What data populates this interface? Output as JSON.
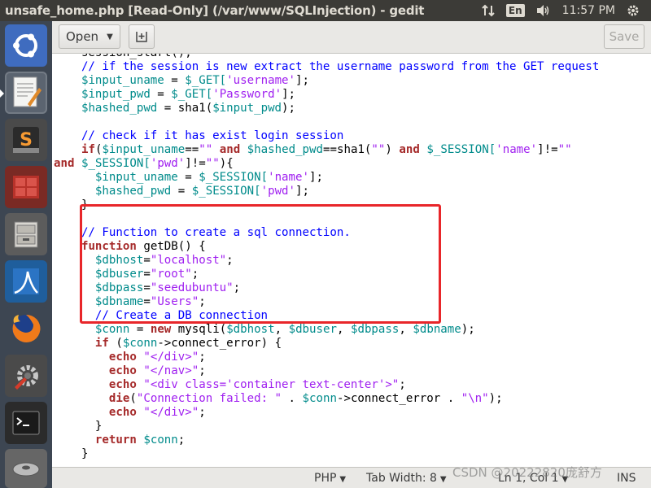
{
  "window": {
    "title": "unsafe_home.php [Read-Only] (/var/www/SQLInjection) - gedit"
  },
  "indicators": {
    "language": "En",
    "clock": "11:57 PM"
  },
  "launcher": {
    "items": [
      {
        "name": "ubuntu-dash-icon"
      },
      {
        "name": "text-editor-icon"
      },
      {
        "name": "sublime-text-icon"
      },
      {
        "name": "workspace-switcher-icon"
      },
      {
        "name": "file-manager-icon"
      },
      {
        "name": "wireshark-icon"
      },
      {
        "name": "firefox-icon"
      },
      {
        "name": "system-settings-icon"
      },
      {
        "name": "terminal-icon"
      },
      {
        "name": "disk-icon"
      }
    ]
  },
  "toolbar": {
    "open_label": "Open",
    "save_label": "Save"
  },
  "code": {
    "lines": [
      [
        {
          "t": "    session_start();",
          "c": ""
        }
      ],
      [
        {
          "t": "    // if the session is new extract the username password from the GET request",
          "c": "cmt"
        }
      ],
      [
        {
          "t": "    ",
          "c": ""
        },
        {
          "t": "$input_uname",
          "c": "var"
        },
        {
          "t": " = ",
          "c": ""
        },
        {
          "t": "$_GET[",
          "c": "var"
        },
        {
          "t": "'username'",
          "c": "str"
        },
        {
          "t": "];",
          "c": ""
        }
      ],
      [
        {
          "t": "    ",
          "c": ""
        },
        {
          "t": "$input_pwd",
          "c": "var"
        },
        {
          "t": " = ",
          "c": ""
        },
        {
          "t": "$_GET[",
          "c": "var"
        },
        {
          "t": "'Password'",
          "c": "str"
        },
        {
          "t": "];",
          "c": ""
        }
      ],
      [
        {
          "t": "    ",
          "c": ""
        },
        {
          "t": "$hashed_pwd",
          "c": "var"
        },
        {
          "t": " = sha1(",
          "c": ""
        },
        {
          "t": "$input_pwd",
          "c": "var"
        },
        {
          "t": ");",
          "c": ""
        }
      ],
      [
        {
          "t": "",
          "c": ""
        }
      ],
      [
        {
          "t": "    // check if it has exist login session",
          "c": "cmt"
        }
      ],
      [
        {
          "t": "    ",
          "c": ""
        },
        {
          "t": "if",
          "c": "kw"
        },
        {
          "t": "(",
          "c": ""
        },
        {
          "t": "$input_uname",
          "c": "var"
        },
        {
          "t": "==",
          "c": ""
        },
        {
          "t": "\"\"",
          "c": "str"
        },
        {
          "t": " and ",
          "c": "kw"
        },
        {
          "t": "$hashed_pwd",
          "c": "var"
        },
        {
          "t": "==sha1(",
          "c": ""
        },
        {
          "t": "\"\"",
          "c": "str"
        },
        {
          "t": ") ",
          "c": ""
        },
        {
          "t": "and",
          "c": "kw"
        },
        {
          "t": " ",
          "c": ""
        },
        {
          "t": "$_SESSION[",
          "c": "var"
        },
        {
          "t": "'name'",
          "c": "str"
        },
        {
          "t": "]!=",
          "c": ""
        },
        {
          "t": "\"\"",
          "c": "str"
        }
      ],
      [
        {
          "t": "and",
          "c": "kw"
        },
        {
          "t": " ",
          "c": ""
        },
        {
          "t": "$_SESSION[",
          "c": "var"
        },
        {
          "t": "'pwd'",
          "c": "str"
        },
        {
          "t": "]!=",
          "c": ""
        },
        {
          "t": "\"\"",
          "c": "str"
        },
        {
          "t": "){",
          "c": ""
        }
      ],
      [
        {
          "t": "      ",
          "c": ""
        },
        {
          "t": "$input_uname",
          "c": "var"
        },
        {
          "t": " = ",
          "c": ""
        },
        {
          "t": "$_SESSION[",
          "c": "var"
        },
        {
          "t": "'name'",
          "c": "str"
        },
        {
          "t": "];",
          "c": ""
        }
      ],
      [
        {
          "t": "      ",
          "c": ""
        },
        {
          "t": "$hashed_pwd",
          "c": "var"
        },
        {
          "t": " = ",
          "c": ""
        },
        {
          "t": "$_SESSION[",
          "c": "var"
        },
        {
          "t": "'pwd'",
          "c": "str"
        },
        {
          "t": "];",
          "c": ""
        }
      ],
      [
        {
          "t": "    }",
          "c": ""
        }
      ],
      [
        {
          "t": "",
          "c": ""
        }
      ],
      [
        {
          "t": "    // Function to create a sql connection.",
          "c": "cmt"
        }
      ],
      [
        {
          "t": "    ",
          "c": ""
        },
        {
          "t": "function",
          "c": "kw"
        },
        {
          "t": " getDB() {",
          "c": ""
        }
      ],
      [
        {
          "t": "      ",
          "c": ""
        },
        {
          "t": "$dbhost",
          "c": "var"
        },
        {
          "t": "=",
          "c": ""
        },
        {
          "t": "\"localhost\"",
          "c": "str"
        },
        {
          "t": ";",
          "c": ""
        }
      ],
      [
        {
          "t": "      ",
          "c": ""
        },
        {
          "t": "$dbuser",
          "c": "var"
        },
        {
          "t": "=",
          "c": ""
        },
        {
          "t": "\"root\"",
          "c": "str"
        },
        {
          "t": ";",
          "c": ""
        }
      ],
      [
        {
          "t": "      ",
          "c": ""
        },
        {
          "t": "$dbpass",
          "c": "var"
        },
        {
          "t": "=",
          "c": ""
        },
        {
          "t": "\"seedubuntu\"",
          "c": "str"
        },
        {
          "t": ";",
          "c": ""
        }
      ],
      [
        {
          "t": "      ",
          "c": ""
        },
        {
          "t": "$dbname",
          "c": "var"
        },
        {
          "t": "=",
          "c": ""
        },
        {
          "t": "\"Users\"",
          "c": "str"
        },
        {
          "t": ";",
          "c": ""
        }
      ],
      [
        {
          "t": "      // Create a DB connection",
          "c": "cmt"
        }
      ],
      [
        {
          "t": "      ",
          "c": ""
        },
        {
          "t": "$conn",
          "c": "var"
        },
        {
          "t": " = ",
          "c": ""
        },
        {
          "t": "new",
          "c": "kw"
        },
        {
          "t": " mysqli(",
          "c": ""
        },
        {
          "t": "$dbhost",
          "c": "var"
        },
        {
          "t": ", ",
          "c": ""
        },
        {
          "t": "$dbuser",
          "c": "var"
        },
        {
          "t": ", ",
          "c": ""
        },
        {
          "t": "$dbpass",
          "c": "var"
        },
        {
          "t": ", ",
          "c": ""
        },
        {
          "t": "$dbname",
          "c": "var"
        },
        {
          "t": ");",
          "c": ""
        }
      ],
      [
        {
          "t": "      ",
          "c": ""
        },
        {
          "t": "if",
          "c": "kw"
        },
        {
          "t": " (",
          "c": ""
        },
        {
          "t": "$conn",
          "c": "var"
        },
        {
          "t": "->connect_error) {",
          "c": ""
        }
      ],
      [
        {
          "t": "        ",
          "c": ""
        },
        {
          "t": "echo",
          "c": "kw"
        },
        {
          "t": " ",
          "c": ""
        },
        {
          "t": "\"</div>\"",
          "c": "str"
        },
        {
          "t": ";",
          "c": ""
        }
      ],
      [
        {
          "t": "        ",
          "c": ""
        },
        {
          "t": "echo",
          "c": "kw"
        },
        {
          "t": " ",
          "c": ""
        },
        {
          "t": "\"</nav>\"",
          "c": "str"
        },
        {
          "t": ";",
          "c": ""
        }
      ],
      [
        {
          "t": "        ",
          "c": ""
        },
        {
          "t": "echo",
          "c": "kw"
        },
        {
          "t": " ",
          "c": ""
        },
        {
          "t": "\"<div class='container text-center'>\"",
          "c": "str"
        },
        {
          "t": ";",
          "c": ""
        }
      ],
      [
        {
          "t": "        ",
          "c": ""
        },
        {
          "t": "die",
          "c": "kw"
        },
        {
          "t": "(",
          "c": ""
        },
        {
          "t": "\"Connection failed: \"",
          "c": "str"
        },
        {
          "t": " . ",
          "c": ""
        },
        {
          "t": "$conn",
          "c": "var"
        },
        {
          "t": "->connect_error . ",
          "c": ""
        },
        {
          "t": "\"\\n\"",
          "c": "str"
        },
        {
          "t": ");",
          "c": ""
        }
      ],
      [
        {
          "t": "        ",
          "c": ""
        },
        {
          "t": "echo",
          "c": "kw"
        },
        {
          "t": " ",
          "c": ""
        },
        {
          "t": "\"</div>\"",
          "c": "str"
        },
        {
          "t": ";",
          "c": ""
        }
      ],
      [
        {
          "t": "      }",
          "c": ""
        }
      ],
      [
        {
          "t": "      ",
          "c": ""
        },
        {
          "t": "return",
          "c": "kw"
        },
        {
          "t": " ",
          "c": ""
        },
        {
          "t": "$conn",
          "c": "var"
        },
        {
          "t": ";",
          "c": ""
        }
      ],
      [
        {
          "t": "    }",
          "c": ""
        }
      ]
    ]
  },
  "statusbar": {
    "language": "PHP",
    "tab_width": "Tab Width: 8",
    "position": "Ln 1, Col 1",
    "mode": "INS"
  },
  "watermark": "CSDN @20222820庞舒方",
  "colors": {
    "annotation_box": "#e8262a",
    "variable": "#008b8b",
    "string": "#a020f0",
    "keyword": "#a52a2a",
    "comment": "#0000ff"
  }
}
